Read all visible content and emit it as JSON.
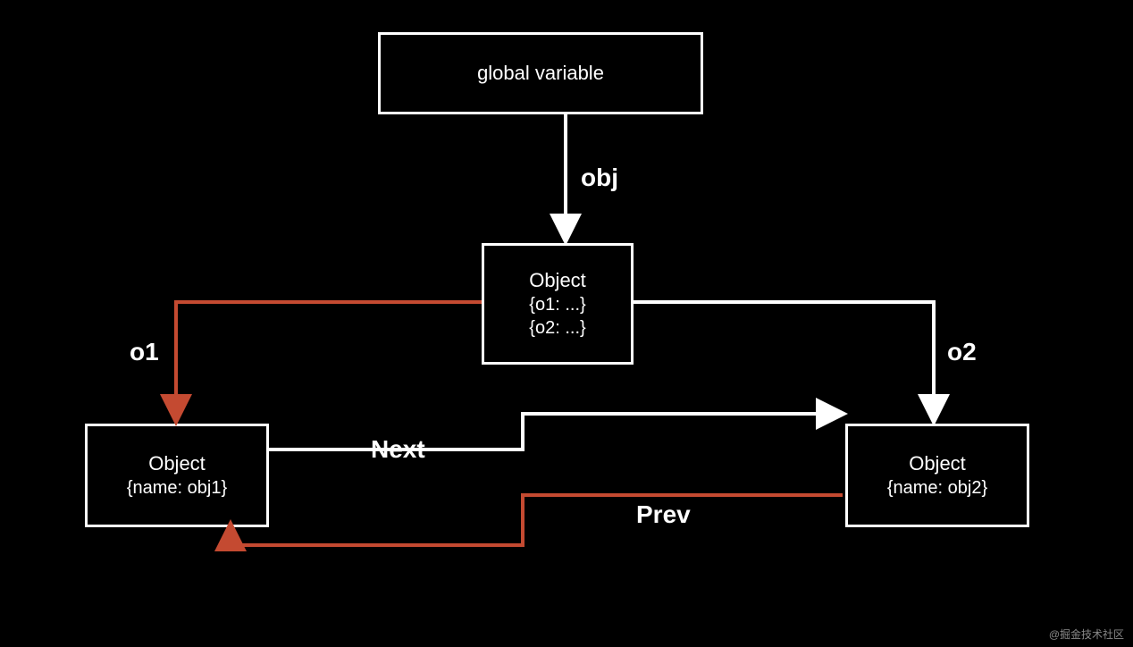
{
  "chart_data": {
    "type": "diagram",
    "nodes": [
      {
        "id": "global",
        "label": "global variable"
      },
      {
        "id": "obj",
        "label": "Object",
        "props": [
          "{o1:  ...}",
          "{o2:  ...}"
        ]
      },
      {
        "id": "obj1",
        "label": "Object",
        "props": [
          "{name: obj1}"
        ]
      },
      {
        "id": "obj2",
        "label": "Object",
        "props": [
          "{name: obj2}"
        ]
      }
    ],
    "edges": [
      {
        "from": "global",
        "to": "obj",
        "label": "obj",
        "style": "white"
      },
      {
        "from": "obj",
        "to": "obj1",
        "label": "o1",
        "style": "red"
      },
      {
        "from": "obj",
        "to": "obj2",
        "label": "o2",
        "style": "white"
      },
      {
        "from": "obj1",
        "to": "obj2",
        "label": "Next",
        "style": "white"
      },
      {
        "from": "obj2",
        "to": "obj1",
        "label": "Prev",
        "style": "red"
      }
    ]
  },
  "boxes": {
    "global": {
      "title": "global variable"
    },
    "obj": {
      "title": "Object",
      "line1": "{o1:  ...}",
      "line2": "{o2:  ...}"
    },
    "obj1": {
      "title": "Object",
      "line1": "{name: obj1}"
    },
    "obj2": {
      "title": "Object",
      "line1": "{name: obj2}"
    }
  },
  "labels": {
    "obj": "obj",
    "o1": "o1",
    "o2": "o2",
    "next": "Next",
    "prev": "Prev"
  },
  "watermark": "@掘金技术社区",
  "colors": {
    "white": "#ffffff",
    "red": "#c44a31"
  }
}
